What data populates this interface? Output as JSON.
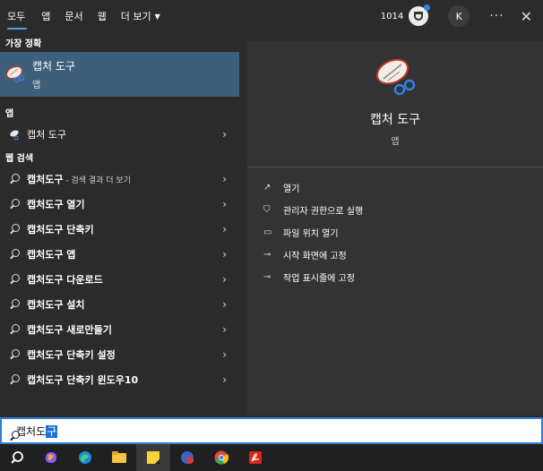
{
  "tabs": [
    "모두",
    "앱",
    "문서",
    "웹",
    "더 보기"
  ],
  "points": "1014",
  "avatar_letter": "K",
  "left": {
    "best_label": "가장 정확",
    "best_title": "캡처 도구",
    "best_sub": "앱",
    "apps_label": "앱",
    "app_item": "캡처 도구",
    "web_label": "웹 검색",
    "web_first": "캡처도구",
    "web_first_extra": " - 검색 결과 더 보기",
    "web_items": [
      "캡처도구 열기",
      "캡처도구 단축키",
      "캡처도구 앱",
      "캡처도구 다운로드",
      "캡처도구 설치",
      "캡처도구 새로만들기",
      "캡처도구 단축키 설정",
      "캡처도구 단축키 윈도우10"
    ]
  },
  "right": {
    "title": "캡처 도구",
    "sub": "앱",
    "actions": [
      "열기",
      "관리자 권한으로 실행",
      "파일 위치 열기",
      "시작 화면에 고정",
      "작업 표시줄에 고정"
    ]
  },
  "search": {
    "query_plain": "캡처도",
    "query_selected": "구"
  },
  "colors": {
    "accent": "#2d7fd3",
    "highlight": "#3e5f7b",
    "background": "#2b2b2b",
    "panel": "#333333"
  }
}
